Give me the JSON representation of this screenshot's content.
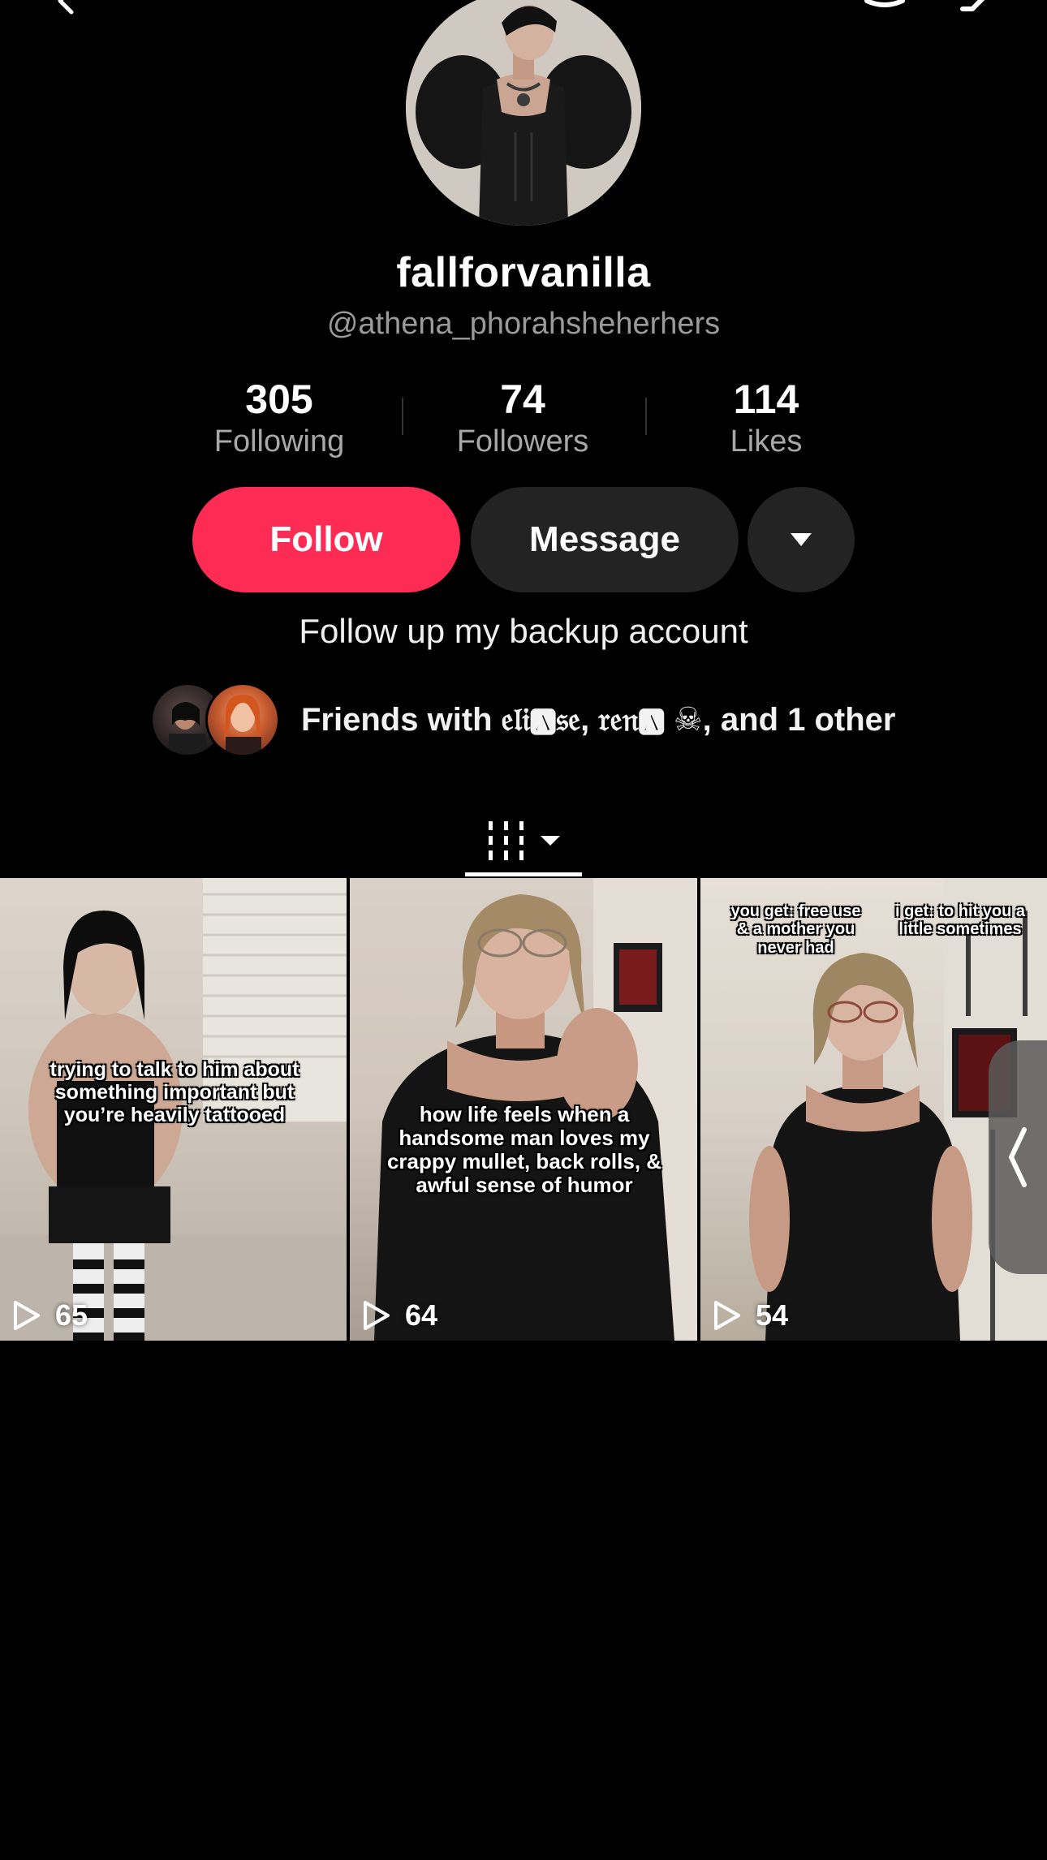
{
  "profile": {
    "display_name": "fallforvanilla",
    "handle": "@athena_phorahsheherhers",
    "bio": "Follow up my backup account",
    "avatar_icon": "profile-avatar"
  },
  "stats": {
    "following": {
      "value": "305",
      "label": "Following"
    },
    "followers": {
      "value": "74",
      "label": "Followers"
    },
    "likes": {
      "value": "114",
      "label": "Likes"
    }
  },
  "actions": {
    "follow_label": "Follow",
    "message_label": "Message",
    "more_icon": "caret-down-icon",
    "follow_color": "#fe2c55"
  },
  "friends": {
    "text": "Friends with 𝔢𝔩𝔦🅰𝔰𝔢, 𝔯𝔢𝔫🅰 ☠︎, and 1 other"
  },
  "tabs": {
    "videos_icon": "grid-bars-icon",
    "dropdown_icon": "caret-down-icon"
  },
  "videos": [
    {
      "caption": "trying to talk to him about something important but you’re heavily tattooed",
      "plays": "65"
    },
    {
      "caption": "how life feels when a handsome man loves my crappy mullet, back rolls, & awful sense of humor",
      "plays": "64"
    },
    {
      "caption_left": "you get: free use & a mother you never had",
      "caption_right": "i get: to hit you a little sometimes",
      "plays": "54"
    }
  ],
  "icons": {
    "top_left": "back-arrow-icon",
    "top_right_1": "bell-icon",
    "top_right_2": "share-icon",
    "drawer": "chevron-left-icon"
  }
}
